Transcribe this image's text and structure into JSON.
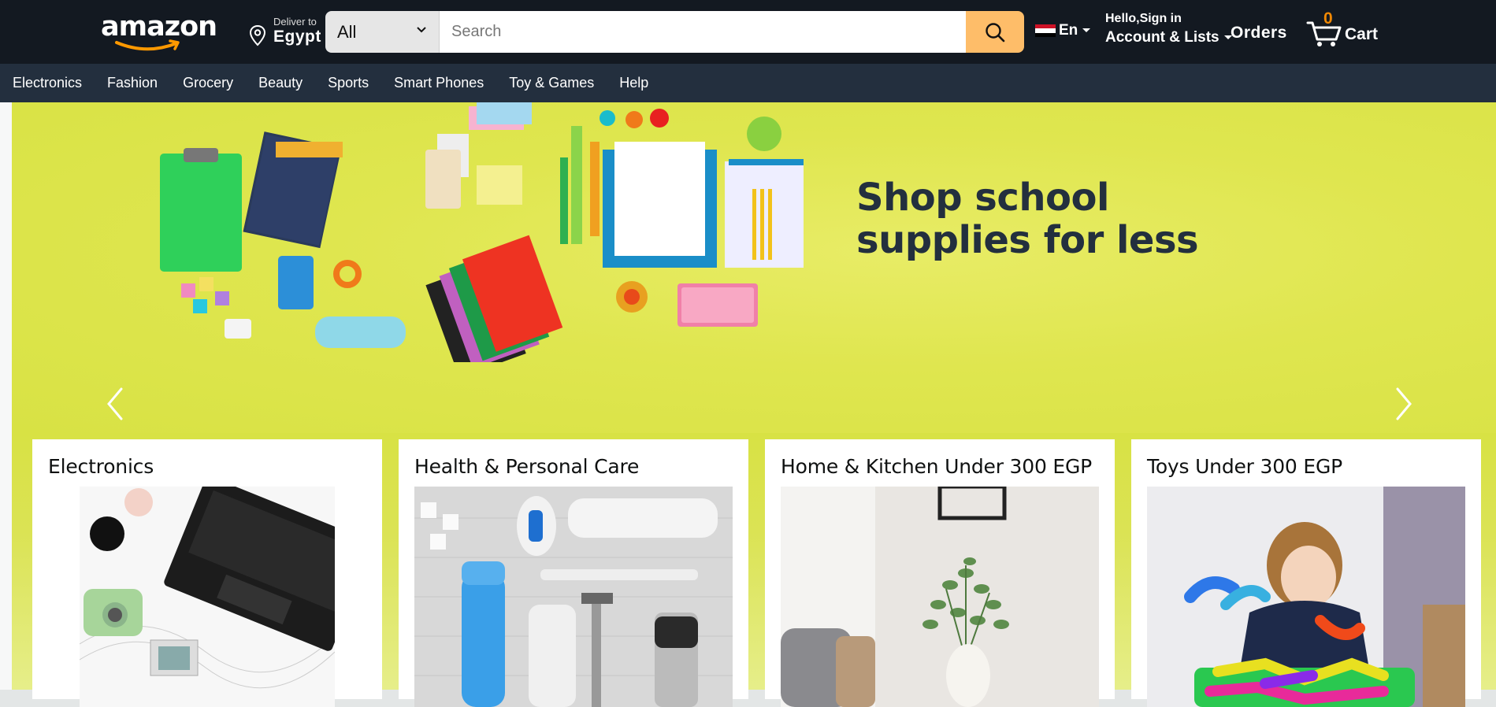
{
  "header": {
    "logo_text": "amazon",
    "deliver_label": "Deliver to",
    "deliver_location": "Egypt",
    "search_category": "All",
    "search_placeholder": "Search",
    "language": "En",
    "greeting": "Hello,Sign in",
    "account_label": "Account & Lists",
    "orders_label": "Orders",
    "cart_count": "0",
    "cart_label": "Cart"
  },
  "nav": {
    "items": [
      "Electronics",
      "Fashion",
      "Grocery",
      "Beauty",
      "Sports",
      "Smart Phones",
      "Toy & Games",
      "Help"
    ]
  },
  "hero": {
    "title_line1": "Shop school",
    "title_line2": "supplies for less"
  },
  "cards": [
    {
      "title": "Electronics"
    },
    {
      "title": "Health & Personal Care"
    },
    {
      "title": "Home & Kitchen Under 300 EGP"
    },
    {
      "title": "Toys Under 300 EGP"
    }
  ],
  "colors": {
    "header_bg": "#131921",
    "nav_bg": "#232f3e",
    "search_button": "#febd69",
    "cart_count": "#f08804",
    "hero_bg": "#dfe64f"
  }
}
